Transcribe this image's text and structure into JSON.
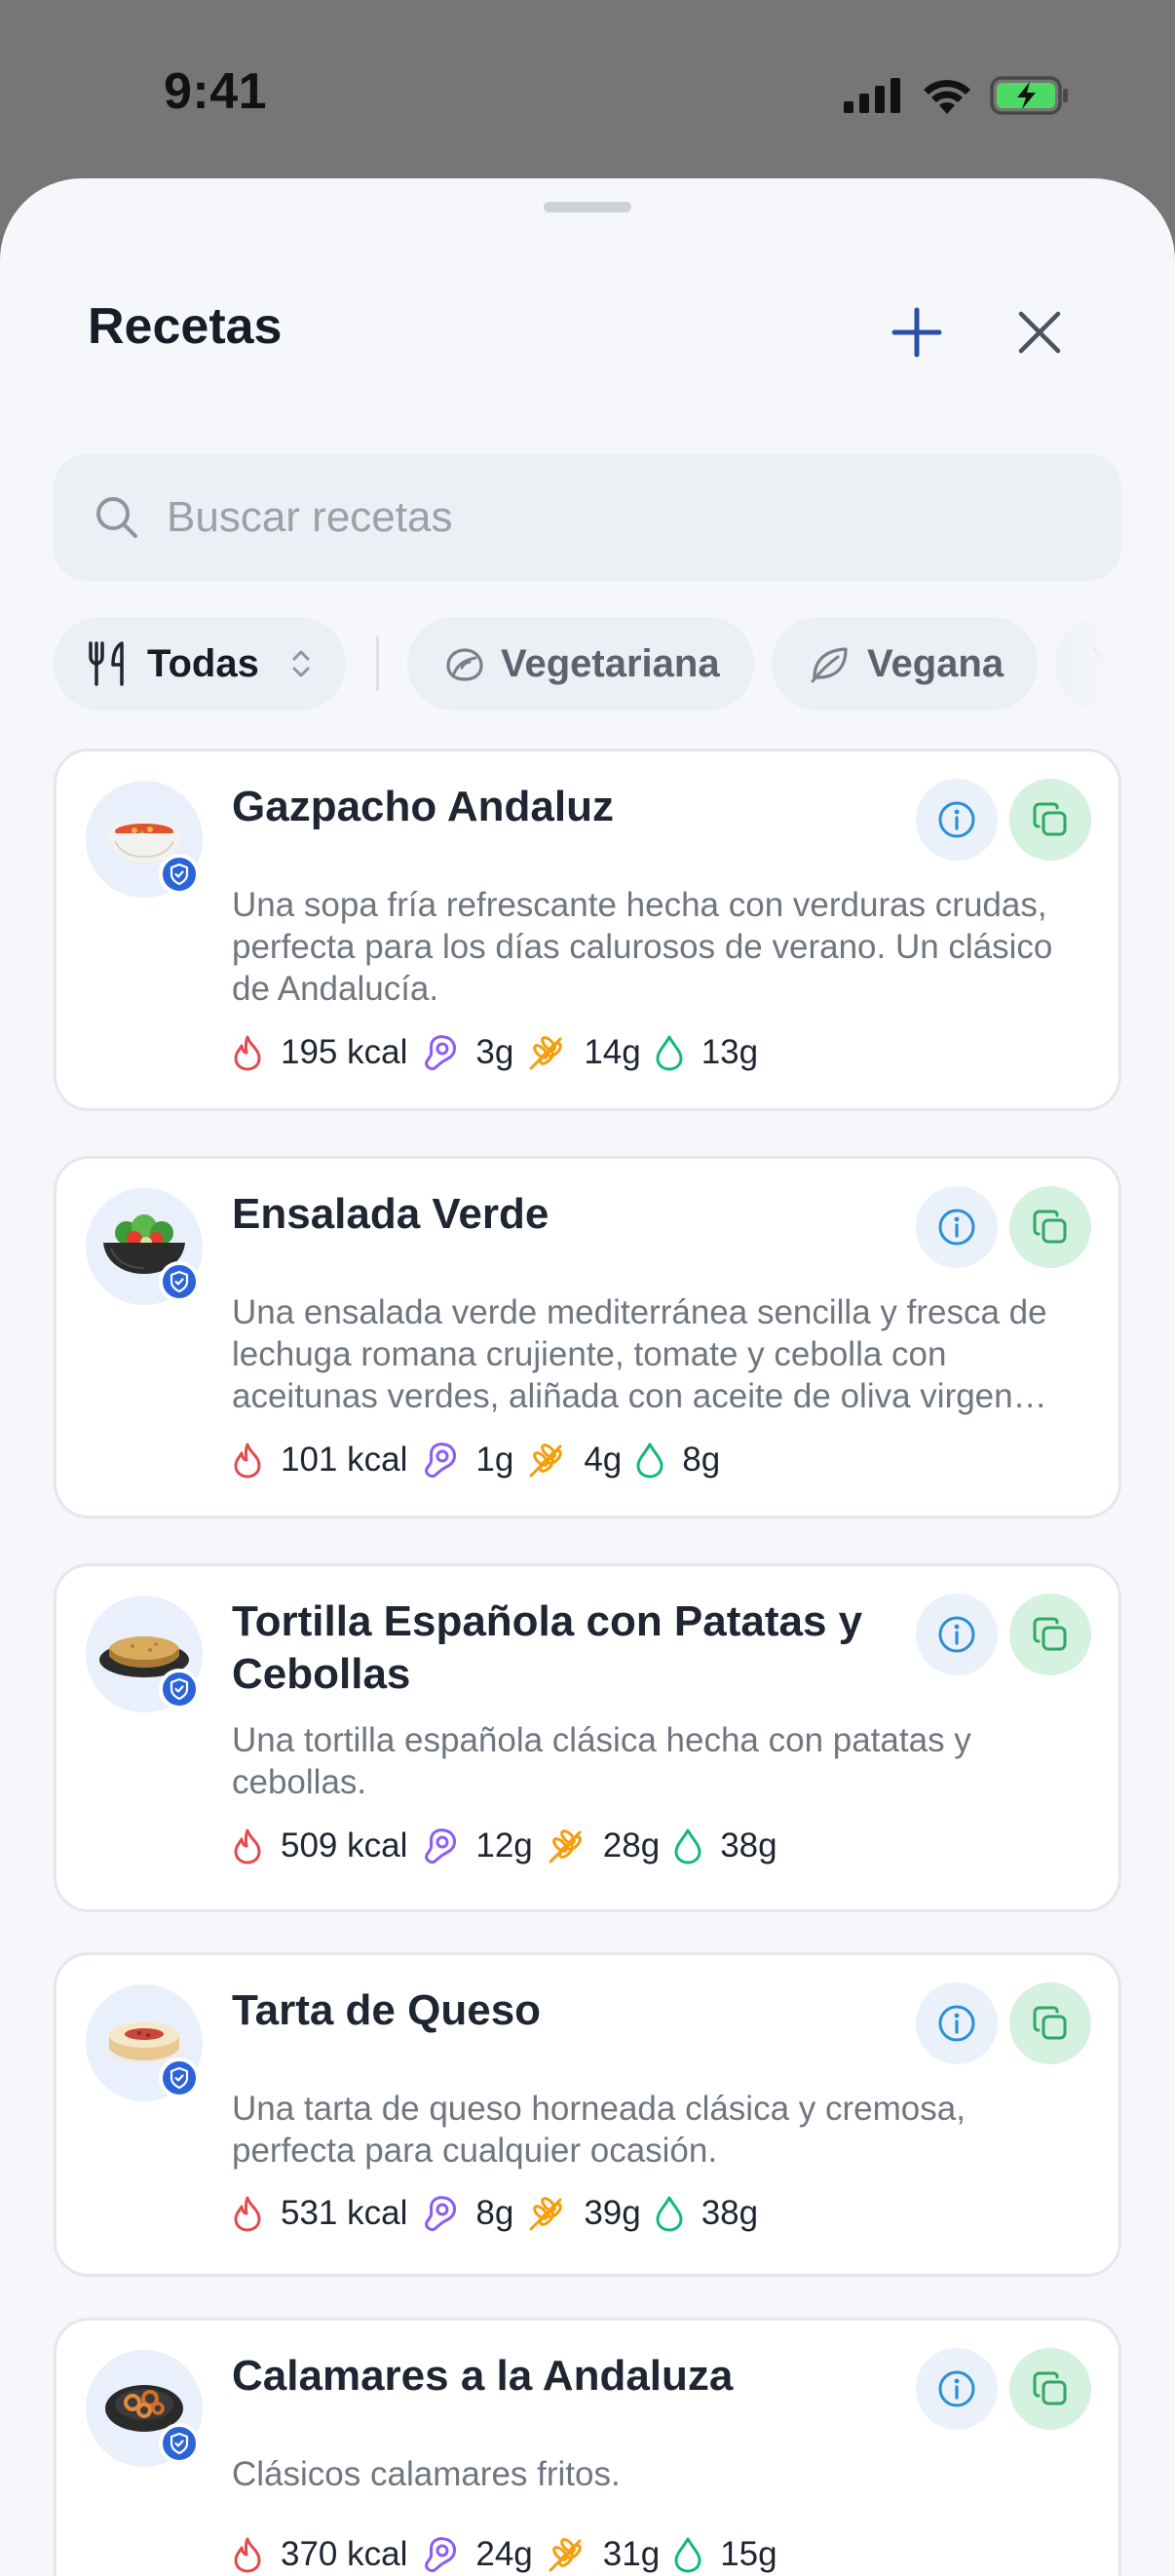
{
  "status_bar": {
    "time": "9:41"
  },
  "header": {
    "title": "Recetas"
  },
  "search": {
    "placeholder": "Buscar recetas",
    "value": ""
  },
  "filters": {
    "selector_label": "Todas",
    "chips": [
      "Vegetariana",
      "Vegana"
    ]
  },
  "recipes": [
    {
      "name": "Gazpacho Andaluz",
      "description": "Una sopa fría refrescante hecha con verduras crudas, perfecta para los días calurosos de verano. Un clásico de Andalucía.",
      "kcal": "195 kcal",
      "protein": "3g",
      "carbs": "14g",
      "fat": "13g",
      "image": "gazpacho-icon"
    },
    {
      "name": "Ensalada Verde",
      "description": "Una ensalada verde mediterránea sencilla y fresca de lechuga romana crujiente, tomate y cebolla con aceitunas verdes, aliñada con aceite de oliva virgen extra.",
      "kcal": "101 kcal",
      "protein": "1g",
      "carbs": "4g",
      "fat": "8g",
      "image": "salad-icon"
    },
    {
      "name": "Tortilla Española con Patatas y Cebollas",
      "description": "Una tortilla española clásica hecha con patatas y cebollas.",
      "kcal": "509 kcal",
      "protein": "12g",
      "carbs": "28g",
      "fat": "38g",
      "image": "tortilla-icon"
    },
    {
      "name": "Tarta de Queso",
      "description": "Una tarta de queso horneada clásica y cremosa, perfecta para cualquier ocasión.",
      "kcal": "531 kcal",
      "protein": "8g",
      "carbs": "39g",
      "fat": "38g",
      "image": "cheesecake-icon"
    },
    {
      "name": "Calamares a la Andaluza",
      "description": "Clásicos calamares fritos.",
      "kcal": "370 kcal",
      "protein": "24g",
      "carbs": "31g",
      "fat": "15g",
      "image": "calamari-icon"
    }
  ],
  "colors": {
    "accent": "#2b4fa8",
    "verified_badge": "#2b63d9",
    "kcal_icon": "#e5484d",
    "protein_icon": "#8b5cf6",
    "carbs_icon": "#f59e0b",
    "fat_icon": "#10b981",
    "copy_button_bg": "#d5f1df",
    "info_button_bg": "#eaf1fb"
  }
}
